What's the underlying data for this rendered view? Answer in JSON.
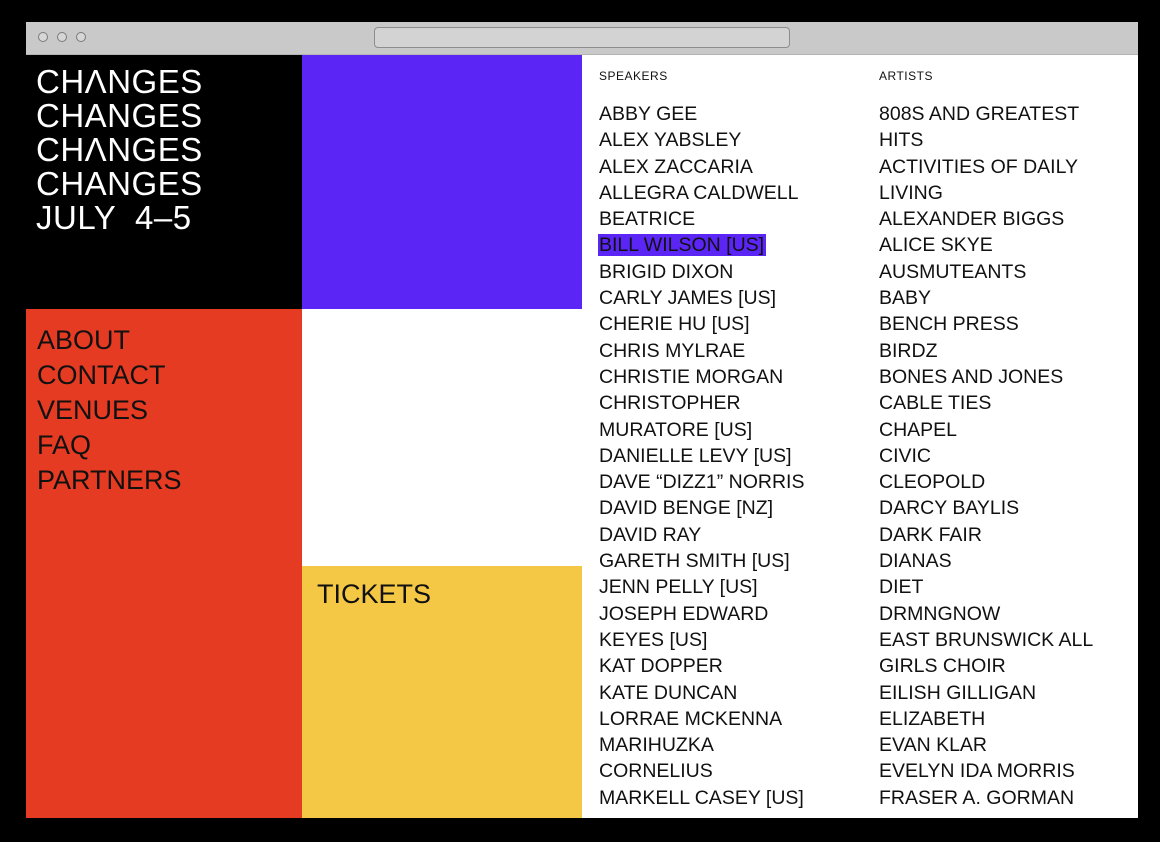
{
  "logo": {
    "lines": [
      "CHɅNGES",
      "CHANGES",
      "CHɅNGES",
      "CHANGES"
    ],
    "date": "JULY  4–5"
  },
  "nav": {
    "items": [
      "ABOUT",
      "CONTACT",
      "VENUES",
      "FAQ",
      "PARTNERS"
    ]
  },
  "tickets": {
    "label": "TICKETS"
  },
  "speakers": {
    "heading": "SPEAKERS",
    "highlighted_index": 5,
    "highlight_color": "#5b25f5",
    "items": [
      "ABBY GEE",
      "ALEX YABSLEY",
      "ALEX ZACCARIA",
      "ALLEGRA CALDWELL",
      "BEATRICE",
      "BILL WILSON [US]",
      "BRIGID DIXON",
      "CARLY JAMES [US]",
      "CHERIE HU [US]",
      "CHRIS MYLRAE",
      "CHRISTIE MORGAN",
      "CHRISTOPHER",
      "MURATORE [US]",
      "DANIELLE LEVY [US]",
      "DAVE “DIZZ1” NORRIS",
      "DAVID BENGE [NZ]",
      "DAVID RAY",
      "GARETH SMITH [US]",
      "JENN PELLY [US]",
      "JOSEPH EDWARD",
      "KEYES [US]",
      "KAT DOPPER",
      "KATE DUNCAN",
      "LORRAE MCKENNA",
      "MARIHUZKA",
      "CORNELIUS",
      "MARKELL CASEY [US]"
    ]
  },
  "artists": {
    "heading": "ARTISTS",
    "items": [
      "808S AND GREATEST",
      "HITS",
      "ACTIVITIES OF DAILY",
      "LIVING",
      "ALEXANDER BIGGS",
      "ALICE SKYE",
      "AUSMUTEANTS",
      "BABY",
      "BENCH PRESS",
      "BIRDZ",
      "BONES AND JONES",
      "CABLE TIES",
      "CHAPEL",
      "CIVIC",
      "CLEOPOLD",
      "DARCY BAYLIS",
      "DARK FAIR",
      "DIANAS",
      "DIET",
      "DRMNGNOW",
      "EAST BRUNSWICK ALL",
      "GIRLS CHOIR",
      "EILISH GILLIGAN",
      "ELIZABETH",
      "EVAN KLAR",
      "EVELYN IDA MORRIS",
      "FRASER A. GORMAN"
    ]
  },
  "colors": {
    "logo_bg": "#000000",
    "purple": "#5b25f5",
    "red": "#e63b23",
    "yellow": "#f4c745"
  }
}
